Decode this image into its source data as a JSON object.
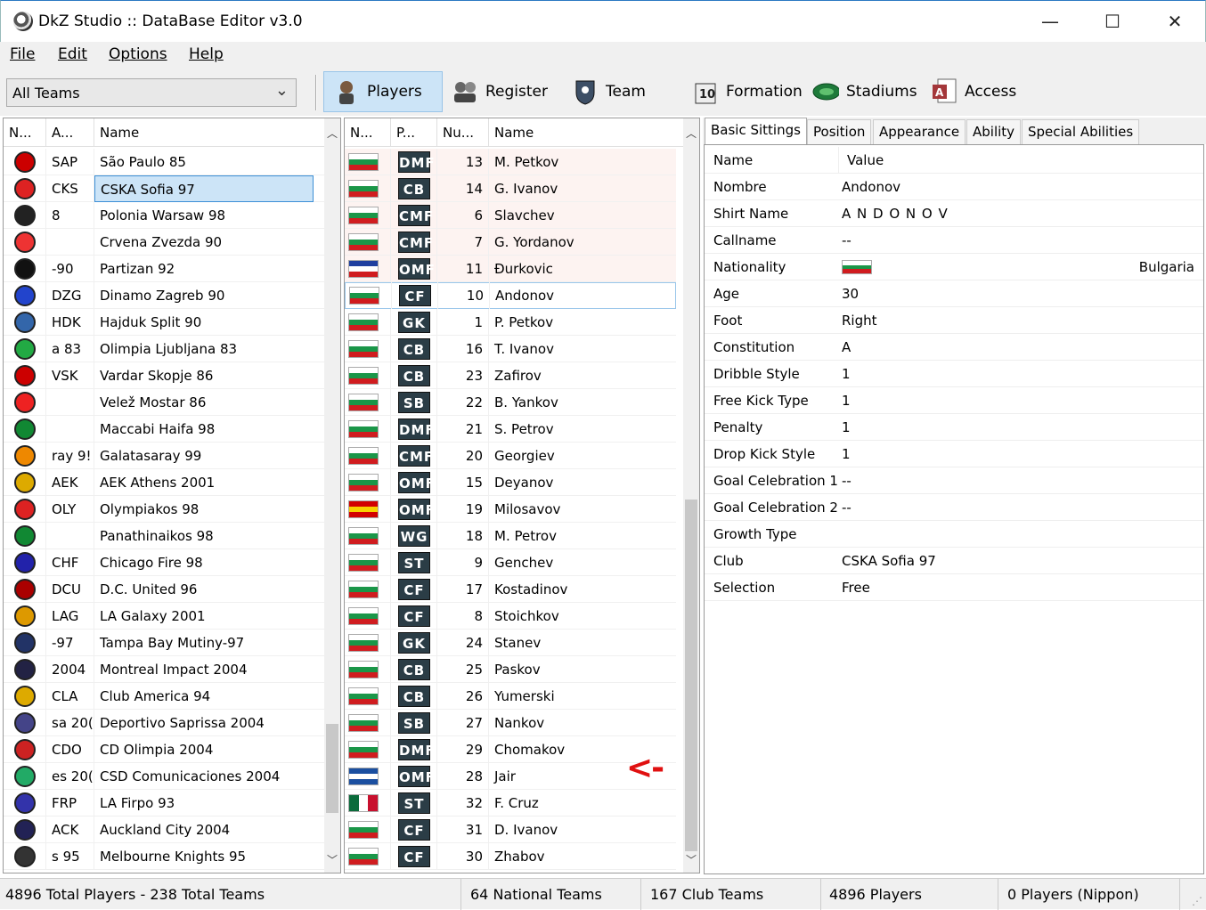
{
  "window": {
    "title": "DkZ Studio :: DataBase Editor v3.0",
    "minimize": "—",
    "maximize": "☐",
    "close": "✕"
  },
  "menu": [
    "File",
    "Edit",
    "Options",
    "Help"
  ],
  "toolbar": {
    "team_select": "All Teams",
    "buttons": [
      {
        "label": "Players",
        "icon": "player-icon",
        "active": true
      },
      {
        "label": "Register",
        "icon": "register-icon"
      },
      {
        "label": "Team",
        "icon": "team-icon"
      },
      {
        "label": "Formation",
        "icon": "formation-icon"
      },
      {
        "label": "Stadiums",
        "icon": "stadium-icon"
      },
      {
        "label": "Access",
        "icon": "access-icon"
      }
    ]
  },
  "teams": {
    "headers": [
      "N...",
      "A...",
      "Name"
    ],
    "rows": [
      {
        "abbr": "SAP",
        "name": "São Paulo 85",
        "color": "#c00"
      },
      {
        "abbr": "CKS",
        "name": "CSKA Sofia 97",
        "color": "#d22",
        "selected": true
      },
      {
        "abbr": "8",
        "name": "Polonia Warsaw 98",
        "color": "#222"
      },
      {
        "abbr": "",
        "name": "Crvena Zvezda 90",
        "color": "#e33"
      },
      {
        "abbr": "-90",
        "name": "Partizan 92",
        "color": "#111"
      },
      {
        "abbr": "DZG",
        "name": "Dinamo Zagreb 90",
        "color": "#24c"
      },
      {
        "abbr": "HDK",
        "name": "Hajduk Split 90",
        "color": "#36a"
      },
      {
        "abbr": "a 83",
        "name": "Olimpia Ljubljana 83",
        "color": "#2a4"
      },
      {
        "abbr": "VSK",
        "name": "Vardar Skopje 86",
        "color": "#c00"
      },
      {
        "abbr": "",
        "name": "Velež Mostar 86",
        "color": "#e22"
      },
      {
        "abbr": "",
        "name": "Maccabi Haifa 98",
        "color": "#183"
      },
      {
        "abbr": "ray 9!",
        "name": "Galatasaray 99",
        "color": "#e80"
      },
      {
        "abbr": "AEK",
        "name": "AEK Athens 2001",
        "color": "#da0"
      },
      {
        "abbr": "OLY",
        "name": "Olympiakos 98",
        "color": "#d22"
      },
      {
        "abbr": "",
        "name": "Panathinaikos 98",
        "color": "#183"
      },
      {
        "abbr": "CHF",
        "name": "Chicago Fire 98",
        "color": "#22a"
      },
      {
        "abbr": "DCU",
        "name": "D.C. United 96",
        "color": "#a00"
      },
      {
        "abbr": "LAG",
        "name": "LA Galaxy 2001",
        "color": "#d90"
      },
      {
        "abbr": "-97",
        "name": "Tampa Bay Mutiny-97",
        "color": "#236"
      },
      {
        "abbr": "2004",
        "name": "Montreal Impact 2004",
        "color": "#224"
      },
      {
        "abbr": "CLA",
        "name": "Club America 94",
        "color": "#da0"
      },
      {
        "abbr": "sa 20(",
        "name": "Deportivo Saprissa 2004",
        "color": "#448"
      },
      {
        "abbr": "CDO",
        "name": "CD Olimpia 2004",
        "color": "#c22"
      },
      {
        "abbr": "es 20(",
        "name": "CSD Comunicaciones 2004",
        "color": "#2a6"
      },
      {
        "abbr": "FRP",
        "name": "LA Firpo 93",
        "color": "#33a"
      },
      {
        "abbr": "ACK",
        "name": "Auckland City 2004",
        "color": "#225"
      },
      {
        "abbr": "s 95",
        "name": "Melbourne Knights 95",
        "color": "#333"
      }
    ]
  },
  "players": {
    "headers": [
      "N...",
      "P...",
      "Nu...",
      "Name"
    ],
    "rows": [
      {
        "flag": "bg",
        "pos": "DMF",
        "num": "13",
        "name": "M. Petkov"
      },
      {
        "flag": "bg",
        "pos": "CB",
        "num": "14",
        "name": "G. Ivanov"
      },
      {
        "flag": "bg",
        "pos": "CMF",
        "num": "6",
        "name": "Slavchev"
      },
      {
        "flag": "bg",
        "pos": "CMF",
        "num": "7",
        "name": "G. Yordanov"
      },
      {
        "flag": "yu",
        "pos": "OMF",
        "num": "11",
        "name": "Đurkovic"
      },
      {
        "flag": "bg",
        "pos": "CF",
        "num": "10",
        "name": "Andonov",
        "selected": true
      },
      {
        "flag": "bg",
        "pos": "GK",
        "num": "1",
        "name": "P. Petkov"
      },
      {
        "flag": "bg",
        "pos": "CB",
        "num": "16",
        "name": "T. Ivanov"
      },
      {
        "flag": "bg",
        "pos": "CB",
        "num": "23",
        "name": "Zafirov"
      },
      {
        "flag": "bg",
        "pos": "SB",
        "num": "22",
        "name": "B. Yankov"
      },
      {
        "flag": "bg",
        "pos": "DMF",
        "num": "21",
        "name": "S. Petrov"
      },
      {
        "flag": "bg",
        "pos": "CMF",
        "num": "20",
        "name": "Georgiev"
      },
      {
        "flag": "bg",
        "pos": "OMF",
        "num": "15",
        "name": "Deyanov"
      },
      {
        "flag": "mk",
        "pos": "OMF",
        "num": "19",
        "name": "Milosavov"
      },
      {
        "flag": "bg",
        "pos": "WG",
        "num": "18",
        "name": "M. Petrov"
      },
      {
        "flag": "bg",
        "pos": "ST",
        "num": "9",
        "name": "Genchev"
      },
      {
        "flag": "bg",
        "pos": "CF",
        "num": "17",
        "name": "Kostadinov"
      },
      {
        "flag": "bg",
        "pos": "CF",
        "num": "8",
        "name": "Stoichkov"
      },
      {
        "flag": "bg",
        "pos": "GK",
        "num": "24",
        "name": "Stanev"
      },
      {
        "flag": "bg",
        "pos": "CB",
        "num": "25",
        "name": "Paskov"
      },
      {
        "flag": "bg",
        "pos": "CB",
        "num": "26",
        "name": "Yumerski"
      },
      {
        "flag": "bg",
        "pos": "SB",
        "num": "27",
        "name": "Nankov"
      },
      {
        "flag": "bg",
        "pos": "DMF",
        "num": "29",
        "name": "Chomakov"
      },
      {
        "flag": "cv",
        "pos": "OMF",
        "num": "28",
        "name": "Jair"
      },
      {
        "flag": "mx",
        "pos": "ST",
        "num": "32",
        "name": "F. Cruz"
      },
      {
        "flag": "bg",
        "pos": "CF",
        "num": "31",
        "name": "D. Ivanov"
      },
      {
        "flag": "bg",
        "pos": "CF",
        "num": "30",
        "name": "Zhabov"
      }
    ]
  },
  "annotation": "<-",
  "tabs": [
    "Basic Sittings",
    "Position",
    "Appearance",
    "Ability",
    "Special Abilities"
  ],
  "properties": {
    "headers": [
      "Name",
      "Value"
    ],
    "rows": [
      {
        "key": "Nombre",
        "value": "Andonov"
      },
      {
        "key": "Shirt Name",
        "value": "A N D O N O V"
      },
      {
        "key": "Callname",
        "value": "--"
      },
      {
        "key": "Nationality",
        "value": "Bulgaria",
        "flag": "bg"
      },
      {
        "key": "Age",
        "value": "30"
      },
      {
        "key": "Foot",
        "value": "Right"
      },
      {
        "key": "Constitution",
        "value": "A"
      },
      {
        "key": "Dribble Style",
        "value": "1"
      },
      {
        "key": "Free Kick Type",
        "value": "1"
      },
      {
        "key": "Penalty",
        "value": "1"
      },
      {
        "key": "Drop Kick Style",
        "value": "1"
      },
      {
        "key": "Goal Celebration 1",
        "value": "--"
      },
      {
        "key": "Goal Celebration 2",
        "value": "--"
      },
      {
        "key": "Growth Type",
        "value": ""
      },
      {
        "key": "Club",
        "value": "CSKA Sofia 97"
      },
      {
        "key": "Selection",
        "value": "Free"
      }
    ]
  },
  "status": [
    "4896 Total Players  -  238 Total Teams",
    "64 National Teams",
    "167 Club Teams",
    "4896 Players",
    "0 Players (Nippon)"
  ]
}
